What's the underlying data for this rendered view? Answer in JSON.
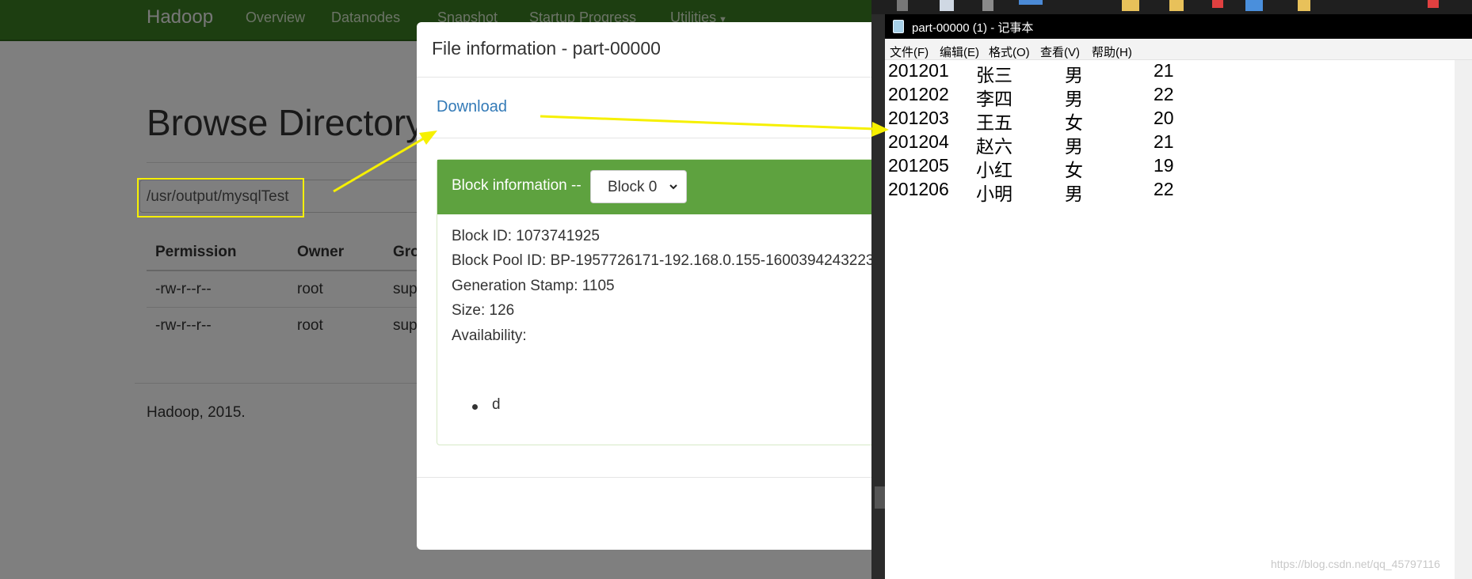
{
  "hadoop": {
    "brand": "Hadoop",
    "nav": [
      "Overview",
      "Datanodes",
      "Snapshot",
      "Startup Progress",
      "Utilities"
    ],
    "page_title": "Browse Directory",
    "path": "/usr/output/mysqlTest",
    "table_headers": [
      "Permission",
      "Owner",
      "Gro"
    ],
    "rows": [
      [
        "-rw-r--r--",
        "root",
        "sup"
      ],
      [
        "-rw-r--r--",
        "root",
        "sup"
      ]
    ],
    "footer": "Hadoop, 2015."
  },
  "modal": {
    "title": "File information - part-00000",
    "download_label": "Download",
    "block_info_label": "Block information --",
    "block_select_value": "Block 0",
    "block_id": "Block ID: 1073741925",
    "block_pool_id": "Block Pool ID: BP-1957726171-192.168.0.155-1600394243223",
    "generation_stamp": "Generation Stamp: 1105",
    "size": "Size: 126",
    "availability_label": "Availability:",
    "availability_items": [
      "d"
    ]
  },
  "notepad": {
    "title": "part-00000 (1) - 记事本",
    "menu": [
      "文件(F)",
      "编辑(E)",
      "格式(O)",
      "查看(V)",
      "帮助(H)"
    ],
    "rows": [
      [
        "201201",
        "张三",
        "男",
        "21"
      ],
      [
        "201202",
        "李四",
        "男",
        "22"
      ],
      [
        "201203",
        "王五",
        "女",
        "20"
      ],
      [
        "201204",
        "赵六",
        "男",
        "21"
      ],
      [
        "201205",
        "小红",
        "女",
        "19"
      ],
      [
        "201206",
        "小明",
        "男",
        "22"
      ]
    ]
  },
  "watermark": "https://blog.csdn.net/qq_45797116",
  "colors": {
    "navbar": "#3b7d23",
    "panel_heading": "#5ea23f",
    "link": "#337ab7",
    "annotation": "#f6f000"
  }
}
